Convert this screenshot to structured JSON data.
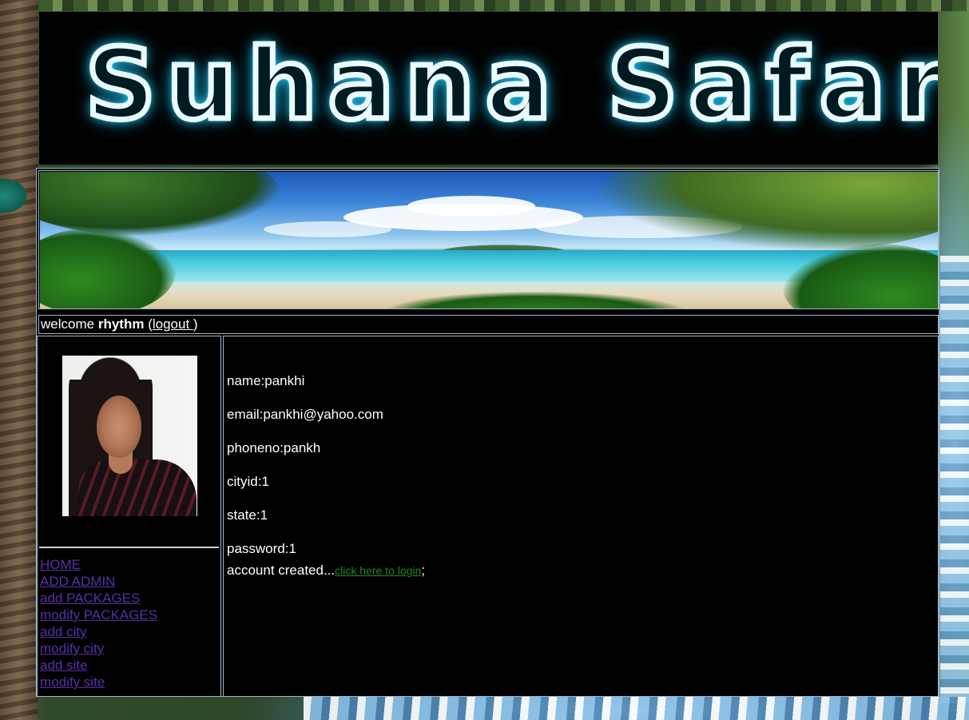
{
  "site": {
    "logo_text": "Suhana Safar"
  },
  "user_bar": {
    "welcome_prefix": "welcome",
    "username": "rhythm",
    "open_paren": "(",
    "logout_label": "logout ",
    "close_paren": ")"
  },
  "sidebar": {
    "items": [
      {
        "label": "HOME"
      },
      {
        "label": "ADD ADMIN"
      },
      {
        "label": "add PACKAGES"
      },
      {
        "label": "modify PACKAGES"
      },
      {
        "label": "add city"
      },
      {
        "label": "modify city"
      },
      {
        "label": "add site"
      },
      {
        "label": "modify site"
      }
    ]
  },
  "account": {
    "name": "name:pankhi",
    "email": "email:pankhi@yahoo.com",
    "phoneno": "phoneno:pankh",
    "cityid": "cityid:1",
    "state": "state:1",
    "password": "password:1",
    "created_text": "account created...",
    "login_link": "click here to login",
    "trailing": ";"
  },
  "colors": {
    "link_nav": "#5a2fa6",
    "link_login": "#1e8a1e",
    "panel_bg": "#000000",
    "border": "#9fb6c8"
  }
}
